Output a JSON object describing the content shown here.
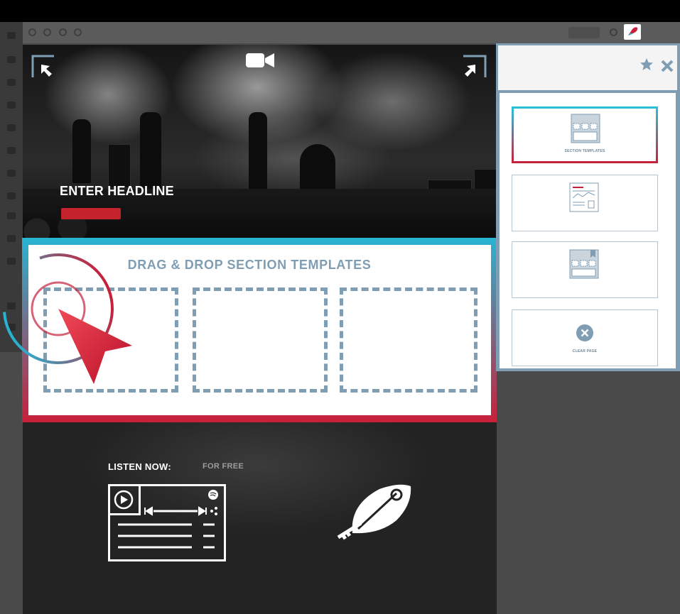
{
  "colors": {
    "accent_teal": "#27b4d3",
    "accent_red": "#c8203a",
    "slate_blue": "#7f9db3",
    "headline_bar": "#c4232e"
  },
  "hero": {
    "headline": "ENTER HEADLINE",
    "camera_icon": "video-camera-icon",
    "corner_icons": [
      "arrow-up-left-icon",
      "arrow-up-right-icon"
    ]
  },
  "drag_section": {
    "title": "DRAG & DROP SECTION TEMPLATES",
    "drop_zones": 3
  },
  "listen": {
    "label": "LISTEN NOW:",
    "sub": "FOR FREE"
  },
  "panel": {
    "star_icon": "star-icon",
    "close_icon": "close-icon",
    "cards": [
      {
        "label": "SECTION TEMPLATES",
        "icon": "section-templates-icon",
        "active": true
      },
      {
        "label": "",
        "icon": "page-template-icon",
        "active": false
      },
      {
        "label": "",
        "icon": "bookmark-template-icon",
        "active": false
      },
      {
        "label": "CLEAR PAGE",
        "icon": "clear-page-icon",
        "active": false
      }
    ]
  }
}
